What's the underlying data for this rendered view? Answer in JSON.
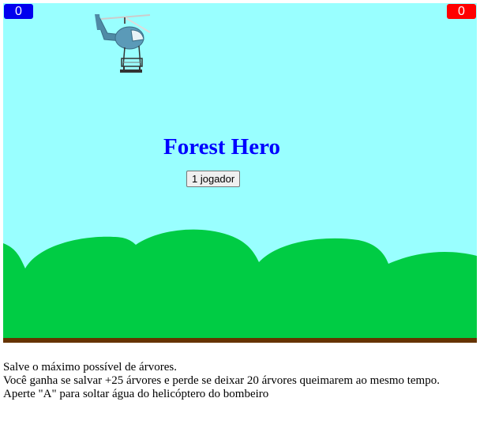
{
  "game": {
    "title": "Forest Hero",
    "start_button": "1 jogador",
    "score_left": "0",
    "score_right": "0",
    "colors": {
      "sky": "#99ffff",
      "trees": "#00cc44",
      "ground": "#663300",
      "title": "#0000ff",
      "score_left_bg": "#0000ee",
      "score_right_bg": "#ff0000"
    }
  },
  "instructions": [
    "Salve o máximo possível de árvores.",
    "Você ganha se salvar +25 árvores e perde se deixar 20 árvores queimarem ao mesmo tempo.",
    "Aperte \"A\" para soltar água do helicóptero do bombeiro"
  ],
  "icons": {
    "helicopter": "helicopter-icon"
  }
}
